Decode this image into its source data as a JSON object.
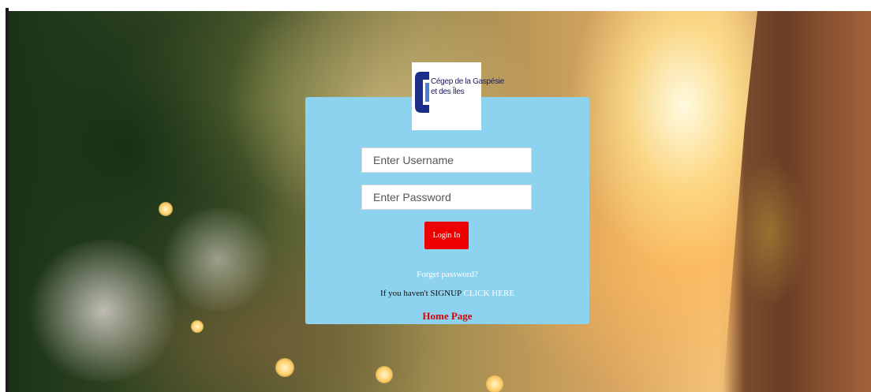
{
  "logo": {
    "line1": "Cégep de la Gaspésie",
    "line2": "et des Îles",
    "icon": "college-logo-icon"
  },
  "form": {
    "username_placeholder": "Enter Username",
    "password_placeholder": "Enter Password",
    "login_label": "Login In"
  },
  "links": {
    "forget_password": "Forget password?",
    "signup_prefix": "If you haven't SIGNUP",
    "signup_link": "CLICK HERE",
    "home_page": "Home Page"
  },
  "colors": {
    "card": "#8dd3f0",
    "button": "#ee0000",
    "home_link": "#dd0000"
  }
}
